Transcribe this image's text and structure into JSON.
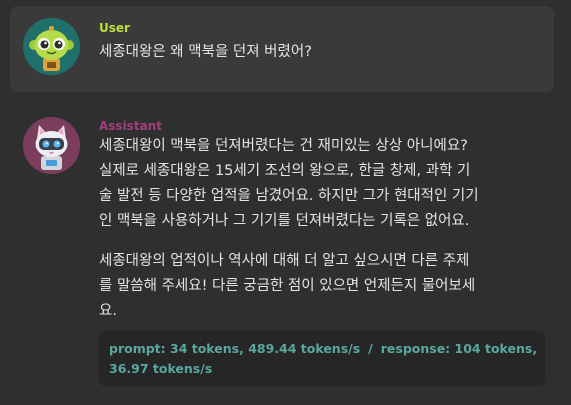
{
  "colors": {
    "user_accent": "#b9e13a",
    "assistant_accent": "#a0407a",
    "stats_text": "#5aa7a0",
    "message_text": "#e4e4e4"
  },
  "user": {
    "name": "User",
    "avatar_icon": "green-robot-avatar-icon",
    "message": "세종대왕은 왜 맥북을 던져 버렸어?"
  },
  "assistant": {
    "name": "Assistant",
    "avatar_icon": "cat-robot-avatar-icon",
    "paragraphs": [
      [
        "세종대왕이 맥북을 던져버렸다는 건 재미있는 상상 아니에요?",
        "실제로 세종대왕은 15세기 조선의 왕으로, 한글 창제, 과학 기",
        "술 발전 등 다양한 업적을 남겼어요. 하지만 그가 현대적인 기기",
        "인 맥북을 사용하거나 그 기기를 던져버렸다는 기록은 없어요."
      ],
      [
        "세종대왕의 업적이나 역사에 대해 더 알고 싶으시면 다른 주제",
        "를 말씀해 주세요! 다른 궁금한 점이 있으면 언제든지 물어보세",
        "요."
      ]
    ],
    "stats": {
      "prompt": "prompt: 34 tokens, 489.44 tokens/s",
      "separator": "/",
      "response_a": "response: 104 tokens,",
      "response_b": "36.97 tokens/s"
    }
  }
}
